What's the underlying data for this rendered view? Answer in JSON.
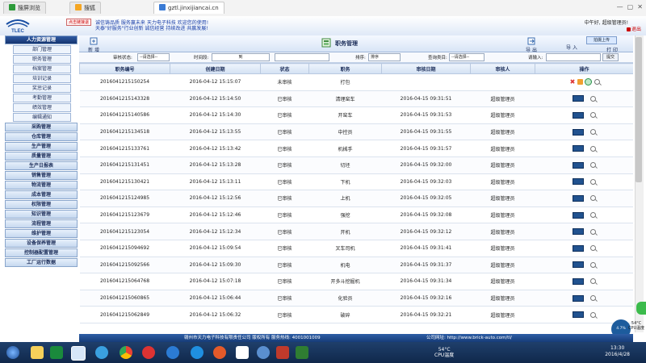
{
  "browser": {
    "tabs": [
      {
        "label": "搜屏浏览",
        "icon_color": "#2d9b3a"
      },
      {
        "label": "搜狐",
        "icon_color": "#f5a623"
      },
      {
        "label": "gztl.jinxijiancai.cn",
        "icon_color": "#3a7bd5"
      }
    ]
  },
  "header": {
    "badge": "点击链接退",
    "marquee_line1": "诚信铸品质 服务赢未来 天力电子科技 欢迎您的使用!",
    "marquee_line2": "天泰\"好服务\"行业创新 诚信经营 持续改进 共赢发展!",
    "greeting": "中午好, 超级管理员!",
    "exit": "退出"
  },
  "sidebar": {
    "groups_top": [
      {
        "label": "人力资源管理",
        "open": true
      }
    ],
    "subitems": [
      "部门管理",
      "职务管理",
      "档案管理",
      "培训记录",
      "奖惩记录",
      "考勤管理",
      "绩效管理",
      "编辑通知"
    ],
    "groups_bottom": [
      "采购管理",
      "仓库管理",
      "生产管理",
      "质量管理",
      "生产日报表",
      "销售管理",
      "物流管理",
      "成本管理",
      "权限管理",
      "知识管理",
      "流程管理",
      "维护管理",
      "设备保养管理",
      "控制器配置管理",
      "工厂运行数据"
    ]
  },
  "page": {
    "title": "职务管理",
    "buttons": {
      "new": "新 增",
      "export": "导 出",
      "import": "导 入",
      "print": "打 印"
    },
    "float_button": "拍摄上传"
  },
  "filters": {
    "audit_status_label": "审核状态:",
    "audit_status_value": "--请选择--",
    "time_label": "时间段:",
    "time_to": "到",
    "sort_label": "排序:",
    "sort_value": "排序",
    "query_label": "查询类目:",
    "query_value": "--请选择--",
    "keyword_label": "请输入:",
    "submit": "提交"
  },
  "table": {
    "columns": [
      "职务编号",
      "创建日期",
      "状态",
      "职务",
      "审核日期",
      "审核人",
      "操作"
    ],
    "rows": [
      [
        "2016041215150254",
        "2016-04-12 15:15:07",
        "未审核",
        "打包",
        "",
        ""
      ],
      [
        "2016041215143328",
        "2016-04-12 15:14:50",
        "已审核",
        "清理窑车",
        "2016-04-15 09:31:51",
        "超级管理员"
      ],
      [
        "2016041215140586",
        "2016-04-12 15:14:30",
        "已审核",
        "开窑车",
        "2016-04-15 09:31:53",
        "超级管理员"
      ],
      [
        "2016041215134518",
        "2016-04-12 15:13:55",
        "已审核",
        "中控员",
        "2016-04-15 09:31:55",
        "超级管理员"
      ],
      [
        "2016041215133761",
        "2016-04-12 15:13:42",
        "已审核",
        "机械手",
        "2016-04-15 09:31:57",
        "超级管理员"
      ],
      [
        "2016041215131451",
        "2016-04-12 15:13:28",
        "已审核",
        "切坯",
        "2016-04-15 09:32:00",
        "超级管理员"
      ],
      [
        "2016041215130421",
        "2016-04-12 15:13:11",
        "已审核",
        "下机",
        "2016-04-15 09:32:03",
        "超级管理员"
      ],
      [
        "2016041215124985",
        "2016-04-12 15:12:56",
        "已审核",
        "上机",
        "2016-04-15 09:32:05",
        "超级管理员"
      ],
      [
        "2016041215123679",
        "2016-04-12 15:12:46",
        "已审核",
        "强挖",
        "2016-04-15 09:32:08",
        "超级管理员"
      ],
      [
        "2016041215123054",
        "2016-04-12 15:12:34",
        "已审核",
        "开机",
        "2016-04-15 09:32:12",
        "超级管理员"
      ],
      [
        "2016041215094692",
        "2016-04-12 15:09:54",
        "已审核",
        "叉车司机",
        "2016-04-15 09:31:41",
        "超级管理员"
      ],
      [
        "2016041215092566",
        "2016-04-12 15:09:30",
        "已审核",
        "机电",
        "2016-04-15 09:31:37",
        "超级管理员"
      ],
      [
        "2016041215064768",
        "2016-04-12 15:07:18",
        "已审核",
        "开多斗挖掘机",
        "2016-04-15 09:31:34",
        "超级管理员"
      ],
      [
        "2016041215060865",
        "2016-04-12 15:06:44",
        "已审核",
        "化验员",
        "2016-04-15 09:32:16",
        "超级管理员"
      ],
      [
        "2016041215062849",
        "2016-04-12 15:06:32",
        "已审核",
        "破碎",
        "2016-04-15 09:32:21",
        "超级管理员"
      ]
    ]
  },
  "footer": {
    "company": "赣州市天力电子科技有限责任公司 版权所有 服务热线: 4001001009",
    "site": "公司网址: http://www.brick-auto.com/tl/"
  },
  "taskbar": {
    "temp": "54°C",
    "temp_label": "CPU温度",
    "time": "13:30",
    "date": "2016/4/28",
    "widget": "4.7%",
    "widget_temp": "54°C",
    "widget_label": "CPU温度"
  }
}
